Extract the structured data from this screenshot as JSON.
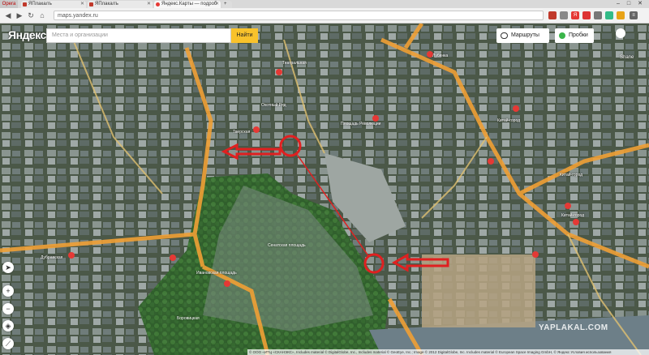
{
  "browser": {
    "menu_label": "Opera",
    "tabs": [
      {
        "label": "ЯПлакалъ"
      },
      {
        "label": "ЯПлакалъ"
      },
      {
        "label": "Яндекс.Карты — подроб"
      }
    ],
    "url": "maps.yandex.ru"
  },
  "map_ui": {
    "logo": "Яндекс",
    "search_placeholder": "Места и организации",
    "search_button": "Найти",
    "routes_button": "Маршруты",
    "traffic_button": "Пробки",
    "edge_label": "Shane",
    "zoom_in": "+",
    "zoom_out": "−",
    "copyright": "© ООО «ИТЦ «СКАНЭКС», Includes material © DigitalGlobe, Inc., Includes material © GeoEye, Inc.; Image © 2012 DigitalGlobe, Inc. Includes material © European Space Imaging GmbH, © Яндекс Условия использования"
  },
  "map_labels": [
    "Охотный Ряд",
    "Театральная",
    "Тверская",
    "Площадь Революции",
    "Лубянка",
    "Китай-город",
    "Китай-город",
    "Китай-город",
    "Сенатская площадь",
    "Ивановская площадь",
    "Боровицкая",
    "Дубравская"
  ],
  "watermark": "YAPLAKAL.COM",
  "colors": {
    "accent_yellow": "#f9c22b",
    "annotation_red": "#e02020",
    "route_orange": "#f0a035"
  }
}
